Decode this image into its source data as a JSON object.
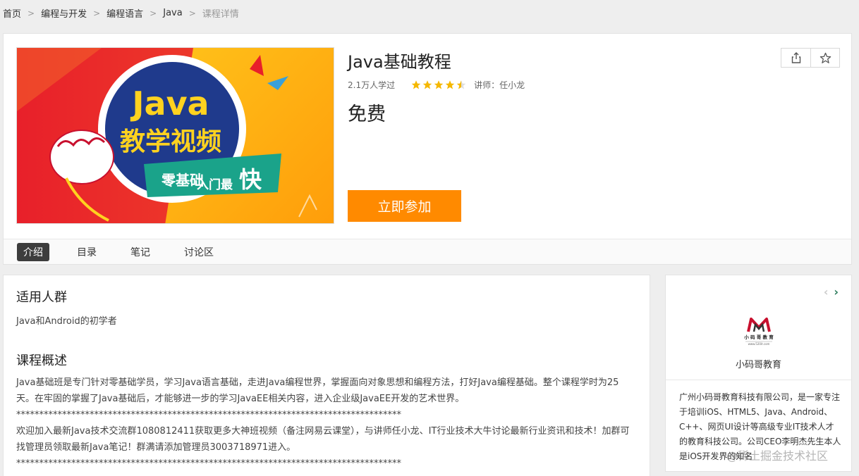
{
  "breadcrumb": {
    "home": "首页",
    "category": "编程与开发",
    "subcategory": "编程语言",
    "topic": "Java",
    "current": "课程详情"
  },
  "course": {
    "title": "Java基础教程",
    "learners": "2.1万人学过",
    "rating": 4.5,
    "instructor": "讲师：任小龙",
    "price": "免费",
    "join_label": "立即参加",
    "cover_text": {
      "java": "Java",
      "video": "教学视频",
      "slogan_a": "零基础",
      "slogan_b": "入门最",
      "slogan_c": "快"
    }
  },
  "actions": {
    "share_icon": "share-icon",
    "favorite_icon": "star-icon"
  },
  "tabs": [
    {
      "label": "介绍",
      "active": true
    },
    {
      "label": "目录",
      "active": false
    },
    {
      "label": "笔记",
      "active": false
    },
    {
      "label": "讨论区",
      "active": false
    }
  ],
  "intro": {
    "audience_title": "适用人群",
    "audience_text": "Java和Android的初学者",
    "overview_title": "课程概述",
    "overview_p1": "Java基础班是专门针对零基础学员，学习Java语言基础，走进Java编程世界，掌握面向对象思想和编程方法，打好Java编程基础。整个课程学时为25天。在牢固的掌握了Java基础后，才能够进一步的学习JavaEE相关内容，进入企业级JavaEE开发的艺术世界。",
    "separator": "************************************************************************************",
    "overview_p2": "欢迎加入最新Java技术交流群1080812411获取更多大神班视频（备注网易云课堂），与讲师任小龙、IT行业技术大牛讨论最新行业资讯和技术！加群可找管理员领取最新Java笔记！群满请添加管理员3003718971进入。",
    "separator2": "************************************************************************************"
  },
  "sidebar": {
    "prev": "‹",
    "next": "›",
    "logo_text": "小 码 哥 教 育",
    "logo_sub": "www.520it.com",
    "org_name": "小码哥教育",
    "org_desc": "广州小码哥教育科技有限公司，是一家专注于培训iOS、HTML5、Java、Android、C++、网页UI设计等高级专业IT技术人才的教育科技公司。公司CEO李明杰先生本人是iOS开发界的知名"
  },
  "watermark": "@稀土掘金技术社区",
  "colors": {
    "accent": "#ff8a00",
    "tab_active": "#3d3d3d",
    "star": "#f5b800",
    "nav_next": "#2a7a5a"
  }
}
